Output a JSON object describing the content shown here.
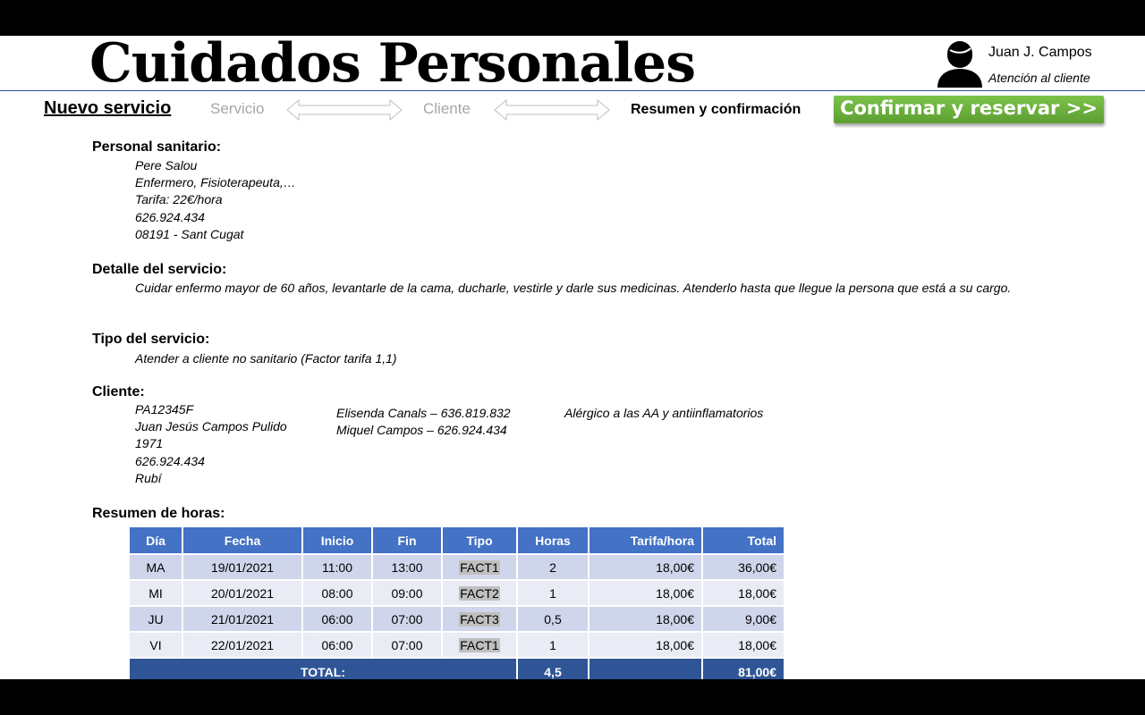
{
  "app": {
    "title": "Cuidados Personales"
  },
  "user": {
    "name": "Juan J. Campos",
    "role": "Atención al cliente"
  },
  "steps": {
    "new_service": "Nuevo servicio",
    "service": "Servicio",
    "client": "Cliente",
    "summary": "Resumen y confirmación"
  },
  "confirm_button": "Confirmar y reservar >>",
  "staff": {
    "heading": "Personal sanitario:",
    "name": "Pere Salou",
    "profession": "Enfermero, Fisioterapeuta,…",
    "rate": "Tarifa: 22€/hora",
    "phone": "626.924.434",
    "location": "08191 - Sant Cugat"
  },
  "detail": {
    "heading": "Detalle del servicio:",
    "text": "Cuidar enfermo mayor de 60 años, levantarle de la cama, ducharle, vestirle y darle sus medicinas. Atenderlo hasta que llegue la persona que está a su cargo."
  },
  "service_type": {
    "heading": "Tipo del servicio:",
    "text": "Atender a cliente no sanitario (Factor tarifa 1,1)"
  },
  "client": {
    "heading": "Cliente:",
    "id": "PA12345F",
    "name": "Juan Jesús Campos Pulido",
    "year": "1971",
    "phone": "626.924.434",
    "city": "Rubí",
    "contacts": [
      "Elisenda Canals – 636.819.832",
      "Miquel Campos – 626.924.434"
    ],
    "notes": "Alérgico a las AA y antiinflamatorios"
  },
  "hours": {
    "heading": "Resumen de horas:",
    "columns": [
      "Día",
      "Fecha",
      "Inicio",
      "Fin",
      "Tipo",
      "Horas",
      "Tarifa/hora",
      "Total"
    ],
    "rows": [
      [
        "MA",
        "19/01/2021",
        "11:00",
        "13:00",
        "FACT1",
        "2",
        "18,00€",
        "36,00€"
      ],
      [
        "MI",
        "20/01/2021",
        "08:00",
        "09:00",
        "FACT2",
        "1",
        "18,00€",
        "18,00€"
      ],
      [
        "JU",
        "21/01/2021",
        "06:00",
        "07:00",
        "FACT3",
        "0,5",
        "18,00€",
        "9,00€"
      ],
      [
        "VI",
        "22/01/2021",
        "06:00",
        "07:00",
        "FACT1",
        "1",
        "18,00€",
        "18,00€"
      ]
    ],
    "total_label": "TOTAL:",
    "total_hours": "4,5",
    "total_amount": "81,00€"
  }
}
